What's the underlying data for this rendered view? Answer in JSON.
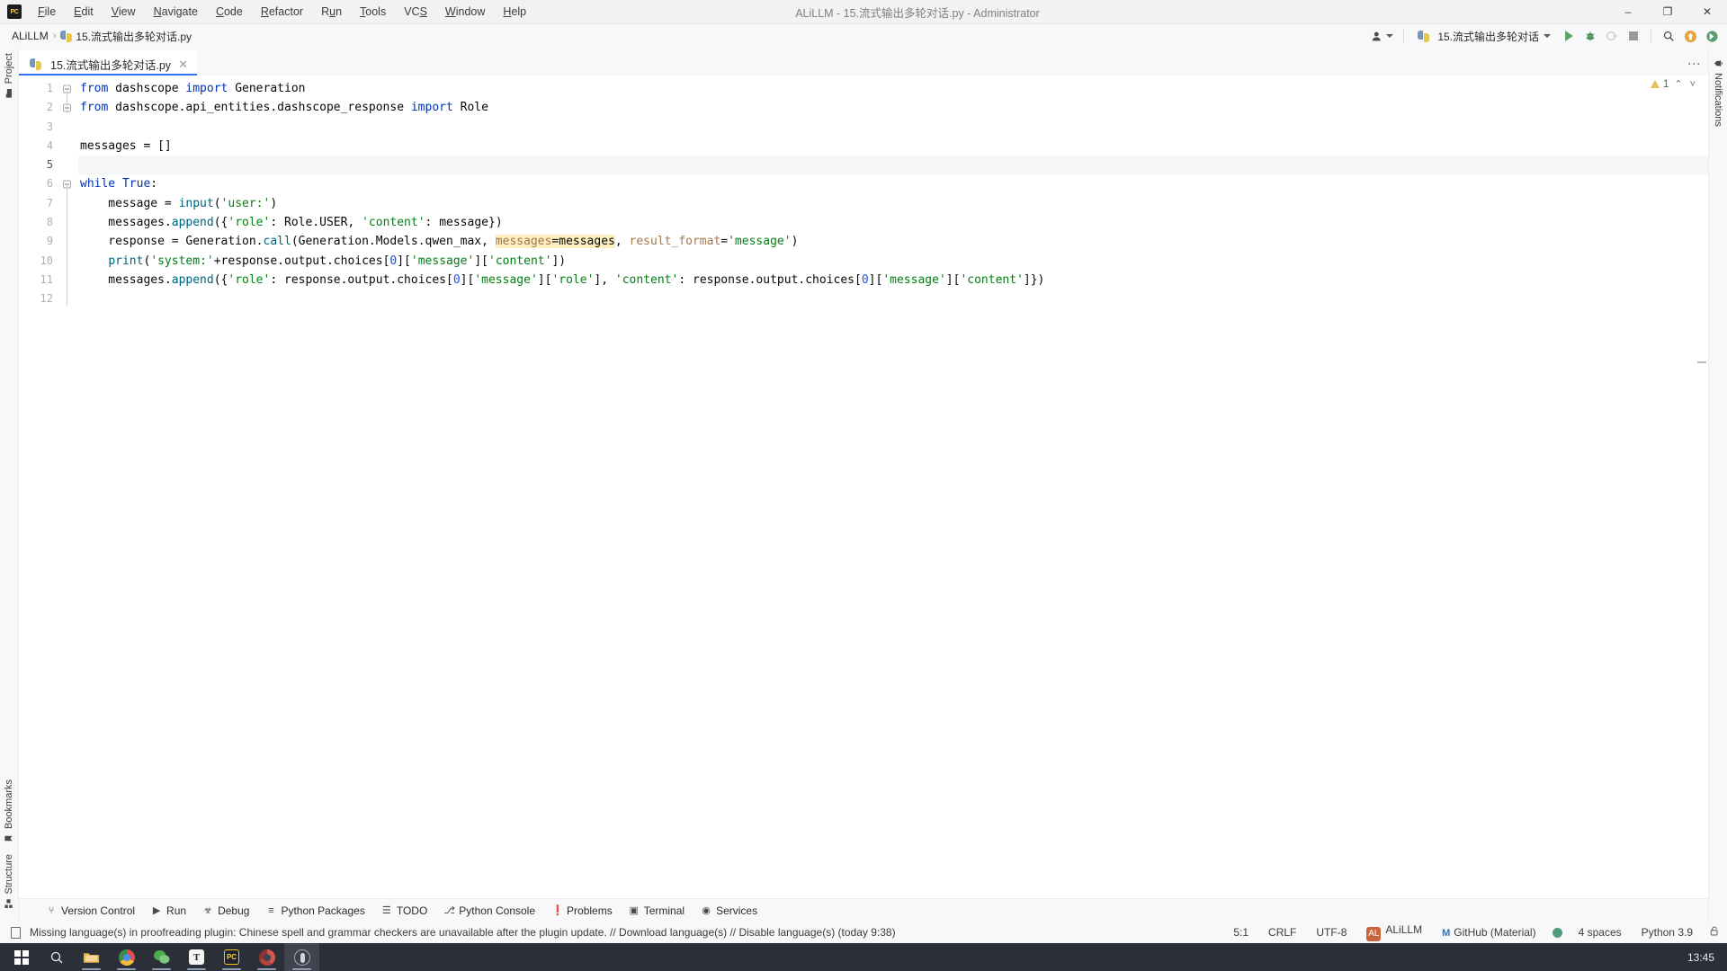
{
  "window": {
    "title": "ALiLLM - 15.流式输出多轮对话.py - Administrator",
    "minimize_label": "–",
    "maximize_label": "❐",
    "close_label": "✕",
    "logo_name": "pycharm-logo"
  },
  "menu": {
    "items": [
      {
        "pre": "",
        "hot": "F",
        "post": "ile"
      },
      {
        "pre": "",
        "hot": "E",
        "post": "dit"
      },
      {
        "pre": "",
        "hot": "V",
        "post": "iew"
      },
      {
        "pre": "",
        "hot": "N",
        "post": "avigate"
      },
      {
        "pre": "",
        "hot": "C",
        "post": "ode"
      },
      {
        "pre": "",
        "hot": "R",
        "post": "efactor"
      },
      {
        "pre": "R",
        "hot": "u",
        "post": "n"
      },
      {
        "pre": "",
        "hot": "T",
        "post": "ools"
      },
      {
        "pre": "VC",
        "hot": "S",
        "post": ""
      },
      {
        "pre": "",
        "hot": "W",
        "post": "indow"
      },
      {
        "pre": "",
        "hot": "H",
        "post": "elp"
      }
    ]
  },
  "breadcrumb": {
    "project": "ALiLLM",
    "separator": "›",
    "file": "15.流式输出多轮对话.py"
  },
  "toolbar": {
    "account_label": "account-icon",
    "run_config": "15.流式输出多轮对话",
    "run_label": "Run",
    "debug_label": "Debug",
    "coverage_label": "Run with Coverage",
    "stop_label": "Stop",
    "search_label": "Search Everywhere",
    "updates_label": "Updates",
    "settings_label": "Settings"
  },
  "left_stripe": {
    "top": [
      {
        "label": "Project",
        "icon": "project-folder-icon"
      }
    ],
    "bottom": [
      {
        "label": "Bookmarks",
        "icon": "bookmark-icon"
      },
      {
        "label": "Structure",
        "icon": "structure-icon"
      }
    ]
  },
  "right_stripe": {
    "items": [
      {
        "label": "Notifications",
        "icon": "bell-icon"
      }
    ]
  },
  "tabs": {
    "items": [
      {
        "label": "15.流式输出多轮对话.py",
        "icon": "python-file-icon",
        "close": "✕",
        "active": true
      }
    ],
    "overflow_label": "⋮"
  },
  "editor": {
    "warning_count": "1",
    "warning_up": "⌃",
    "warning_down": "˅",
    "current_line": 5,
    "lines": [
      {
        "n": 1,
        "fold": true,
        "html": "<span class=\"kw\">from</span> dashscope <span class=\"kw\">import</span> Generation"
      },
      {
        "n": 2,
        "fold": true,
        "html": "<span class=\"kw\">from</span> dashscope.api_entities.dashscope_response <span class=\"kw\">import</span> Role"
      },
      {
        "n": 3,
        "fold": false,
        "html": ""
      },
      {
        "n": 4,
        "fold": false,
        "html": "messages = []"
      },
      {
        "n": 5,
        "fold": false,
        "html": ""
      },
      {
        "n": 6,
        "fold": true,
        "html": "<span class=\"kw\">while</span> <span class=\"kw\">True</span>:"
      },
      {
        "n": 7,
        "fold": false,
        "html": "    message = <span class=\"fn\">input</span>(<span class=\"str\">'user:'</span>)"
      },
      {
        "n": 8,
        "fold": false,
        "html": "    messages.<span class=\"fn\">append</span>({<span class=\"str\">'role'</span>: Role.USER, <span class=\"str\">'content'</span>: message})"
      },
      {
        "n": 9,
        "fold": false,
        "html": "    response = Generation.<span class=\"fn\">call</span>(Generation.Models.qwen_max, <span class=\"hl\"><span class=\"param\">messages</span>=messages</span>, <span class=\"param\">result_format</span>=<span class=\"str\">'message'</span>)"
      },
      {
        "n": 10,
        "fold": false,
        "html": "    <span class=\"fn\">print</span>(<span class=\"str\">'system:'</span>+response.output.choices[<span class=\"num\">0</span>][<span class=\"str\">'message'</span>][<span class=\"str\">'content'</span>])"
      },
      {
        "n": 11,
        "fold": false,
        "html": "    messages.<span class=\"fn\">append</span>({<span class=\"str\">'role'</span>: response.output.choices[<span class=\"num\">0</span>][<span class=\"str\">'message'</span>][<span class=\"str\">'role'</span>], <span class=\"str\">'content'</span>: response.output.choices[<span class=\"num\">0</span>][<span class=\"str\">'message'</span>][<span class=\"str\">'content'</span>]})"
      },
      {
        "n": 12,
        "fold": false,
        "html": ""
      }
    ],
    "plain_text": "from dashscope import Generation\nfrom dashscope.api_entities.dashscope_response import Role\n\nmessages = []\n\nwhile True:\n    message = input('user:')\n    messages.append({'role': Role.USER, 'content': message})\n    response = Generation.call(Generation.Models.qwen_max, messages=messages, result_format='message')\n    print('system:'+response.output.choices[0]['message']['content'])\n    messages.append({'role': response.output.choices[0]['message']['role'], 'content': response.output.choices[0]['message']['content']})\n",
    "highlighted_token": "messages=messages"
  },
  "tool_windows": {
    "items": [
      {
        "label": "Version Control",
        "icon": "branch-icon",
        "glyph": "⑂"
      },
      {
        "label": "Run",
        "icon": "run-icon",
        "glyph": "▶"
      },
      {
        "label": "Debug",
        "icon": "bug-icon",
        "glyph": "☣"
      },
      {
        "label": "Python Packages",
        "icon": "packages-icon",
        "glyph": "≡"
      },
      {
        "label": "TODO",
        "icon": "todo-icon",
        "glyph": "☰"
      },
      {
        "label": "Python Console",
        "icon": "python-console-icon",
        "glyph": "⎇"
      },
      {
        "label": "Problems",
        "icon": "problems-icon",
        "glyph": "❗"
      },
      {
        "label": "Terminal",
        "icon": "terminal-icon",
        "glyph": "▣"
      },
      {
        "label": "Services",
        "icon": "services-icon",
        "glyph": "◉"
      }
    ]
  },
  "status_bar": {
    "message": "Missing language(s) in proofreading plugin: Chinese spell and grammar checkers are unavailable after the plugin update. // Download language(s) // Disable language(s) (today 9:38)",
    "caret_position": "5:1",
    "line_separator": "CRLF",
    "encoding": "UTF-8",
    "project_chip": "AL",
    "project_name": "ALiLLM",
    "vcs_branch": "GitHub (Material)",
    "indent": "4 spaces",
    "interpreter": "Python 3.9",
    "lock_label": "🔓"
  },
  "taskbar": {
    "items": [
      {
        "name": "start-button",
        "icon": "windows-logo"
      },
      {
        "name": "search-button",
        "icon": "search-icon"
      },
      {
        "name": "file-explorer",
        "icon": "folder-icon"
      },
      {
        "name": "chrome",
        "icon": "chrome-icon"
      },
      {
        "name": "wechat",
        "icon": "wechat-icon"
      },
      {
        "name": "typora",
        "icon": "typora-icon"
      },
      {
        "name": "pycharm",
        "icon": "pycharm-icon"
      },
      {
        "name": "browser-2",
        "icon": "browser-icon"
      },
      {
        "name": "obs",
        "icon": "obs-icon"
      }
    ],
    "clock": "13:45"
  },
  "colors": {
    "accent": "#3574f0",
    "run_green": "#59a869",
    "warning": "#e3c05d",
    "keyword": "#0033b3",
    "string": "#067d17",
    "highlight": "#fcefbd",
    "taskbar_bg": "#2b2f38"
  }
}
